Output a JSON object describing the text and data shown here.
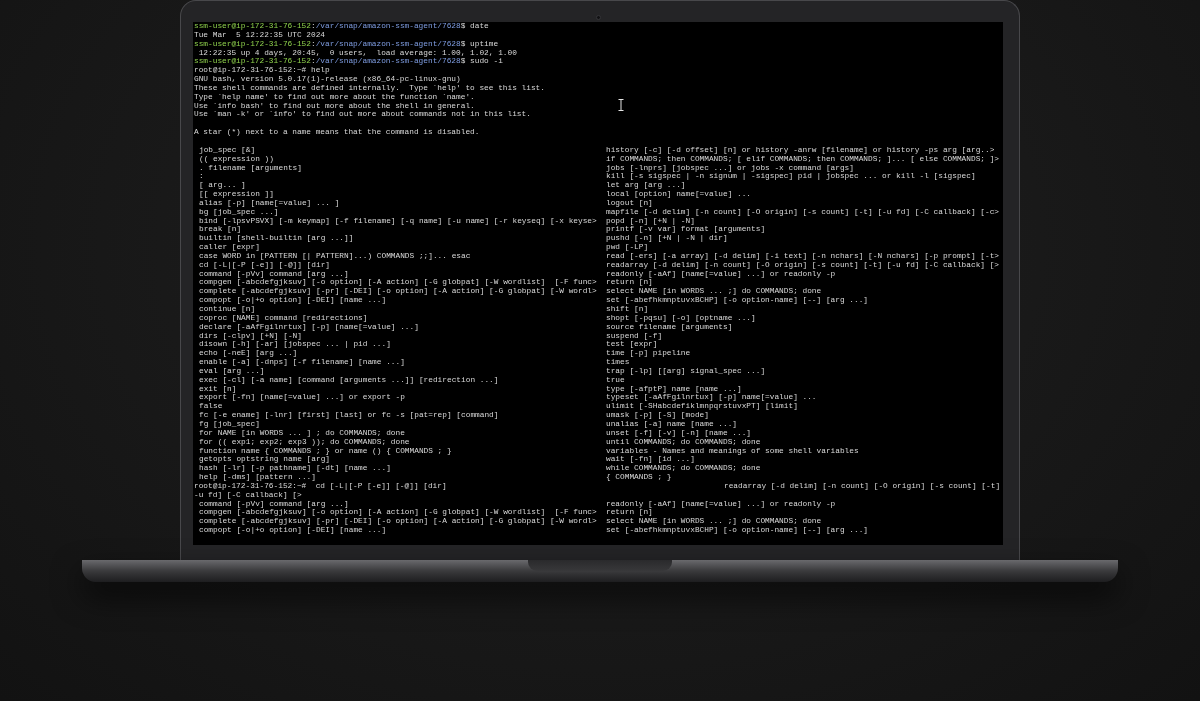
{
  "terminal": {
    "session": [
      {
        "kind": "prompt",
        "segments": [
          {
            "kind": "user",
            "text": "ssm-user@ip-172-31-76-152"
          },
          {
            "kind": "plain",
            "text": ":"
          },
          {
            "kind": "path",
            "text": "/var/snap/amazon-ssm-agent/7628"
          },
          {
            "kind": "plain",
            "text": "$ date"
          }
        ]
      },
      {
        "kind": "output",
        "text": "Tue Mar  5 12:22:35 UTC 2024"
      },
      {
        "kind": "prompt",
        "segments": [
          {
            "kind": "user",
            "text": "ssm-user@ip-172-31-76-152"
          },
          {
            "kind": "plain",
            "text": ":"
          },
          {
            "kind": "path",
            "text": "/var/snap/amazon-ssm-agent/7628"
          },
          {
            "kind": "plain",
            "text": "$ uptime"
          }
        ]
      },
      {
        "kind": "output",
        "text": " 12:22:35 up 4 days, 20:45,  0 users,  load average: 1.00, 1.02, 1.00"
      },
      {
        "kind": "prompt",
        "segments": [
          {
            "kind": "user",
            "text": "ssm-user@ip-172-31-76-152"
          },
          {
            "kind": "plain",
            "text": ":"
          },
          {
            "kind": "path",
            "text": "/var/snap/amazon-ssm-agent/7628"
          },
          {
            "kind": "plain",
            "text": "$ sudo -i"
          }
        ]
      },
      {
        "kind": "output",
        "text": "root@ip-172-31-76-152:~# help"
      },
      {
        "kind": "output",
        "text": "GNU bash, version 5.0.17(1)-release (x86_64-pc-linux-gnu)"
      },
      {
        "kind": "output",
        "text": "These shell commands are defined internally.  Type `help' to see this list."
      },
      {
        "kind": "output",
        "text": "Type `help name' to find out more about the function `name'."
      },
      {
        "kind": "output",
        "text": "Use `info bash' to find out more about the shell in general."
      },
      {
        "kind": "output",
        "text": "Use `man -k' or `info' to find out more about commands not in this list."
      },
      {
        "kind": "blank"
      },
      {
        "kind": "output",
        "text": "A star (*) next to a name means that the command is disabled."
      },
      {
        "kind": "blank"
      }
    ],
    "help_rows": [
      {
        "kind": "entry",
        "left": "job_spec [&]",
        "right": "history [-c] [-d offset] [n] or history -anrw [filename] or history -ps arg [arg..>"
      },
      {
        "kind": "entry",
        "left": "(( expression ))",
        "right": "if COMMANDS; then COMMANDS; [ elif COMMANDS; then COMMANDS; ]... [ else COMMANDS; ]>"
      },
      {
        "kind": "entry",
        "left": ". filename [arguments]",
        "right": "jobs [-lnprs] [jobspec ...] or jobs -x command [args]"
      },
      {
        "kind": "entry",
        "left": ":",
        "right": "kill [-s sigspec | -n signum | -sigspec] pid | jobspec ... or kill -l [sigspec]"
      },
      {
        "kind": "entry",
        "left": "[ arg... ]",
        "right": "let arg [arg ...]"
      },
      {
        "kind": "entry",
        "left": "[[ expression ]]",
        "right": "local [option] name[=value] ..."
      },
      {
        "kind": "entry",
        "left": "alias [-p] [name[=value] ... ]",
        "right": "logout [n]"
      },
      {
        "kind": "entry",
        "left": "bg [job_spec ...]",
        "right": "mapfile [-d delim] [-n count] [-O origin] [-s count] [-t] [-u fd] [-C callback] [-c>"
      },
      {
        "kind": "entry",
        "left": "bind [-lpsvPSVX] [-m keymap] [-f filename] [-q name] [-u name] [-r keyseq] [-x keyse>",
        "right": "popd [-n] [+N | -N]"
      },
      {
        "kind": "entry",
        "left": "break [n]",
        "right": "printf [-v var] format [arguments]"
      },
      {
        "kind": "entry",
        "left": "builtin [shell-builtin [arg ...]]",
        "right": "pushd [-n] [+N | -N | dir]"
      },
      {
        "kind": "entry",
        "left": "caller [expr]",
        "right": "pwd [-LP]"
      },
      {
        "kind": "entry",
        "left": "case WORD in [PATTERN [| PATTERN]...) COMMANDS ;;]... esac",
        "right": "read [-ers] [-a array] [-d delim] [-i text] [-n nchars] [-N nchars] [-p prompt] [-t>"
      },
      {
        "kind": "entry",
        "left": "cd [-L|[-P [-e]] [-@]] [dir]",
        "right": "readarray [-d delim] [-n count] [-O origin] [-s count] [-t] [-u fd] [-C callback] [>"
      },
      {
        "kind": "entry",
        "left": "command [-pVv] command [arg ...]",
        "right": "readonly [-aAf] [name[=value] ...] or readonly -p"
      },
      {
        "kind": "entry",
        "left": "compgen [-abcdefgjksuv] [-o option] [-A action] [-G globpat] [-W wordlist]  [-F func>",
        "right": "return [n]"
      },
      {
        "kind": "entry",
        "left": "complete [-abcdefgjksuv] [-pr] [-DEI] [-o option] [-A action] [-G globpat] [-W wordl>",
        "right": "select NAME [in WORDS ... ;] do COMMANDS; done"
      },
      {
        "kind": "entry",
        "left": "compopt [-o|+o option] [-DEI] [name ...]",
        "right": "set [-abefhkmnptuvxBCHP] [-o option-name] [--] [arg ...]"
      },
      {
        "kind": "entry",
        "left": "continue [n]",
        "right": "shift [n]"
      },
      {
        "kind": "entry",
        "left": "coproc [NAME] command [redirections]",
        "right": "shopt [-pqsu] [-o] [optname ...]"
      },
      {
        "kind": "entry",
        "left": "declare [-aAfFgilnrtux] [-p] [name[=value] ...]",
        "right": "source filename [arguments]"
      },
      {
        "kind": "entry",
        "left": "dirs [-clpv] [+N] [-N]",
        "right": "suspend [-f]"
      },
      {
        "kind": "entry",
        "left": "disown [-h] [-ar] [jobspec ... | pid ...]",
        "right": "test [expr]"
      },
      {
        "kind": "entry",
        "left": "echo [-neE] [arg ...]",
        "right": "time [-p] pipeline"
      },
      {
        "kind": "entry",
        "left": "enable [-a] [-dnps] [-f filename] [name ...]",
        "right": "times"
      },
      {
        "kind": "entry",
        "left": "eval [arg ...]",
        "right": "trap [-lp] [[arg] signal_spec ...]"
      },
      {
        "kind": "entry",
        "left": "exec [-cl] [-a name] [command [arguments ...]] [redirection ...]",
        "right": "true"
      },
      {
        "kind": "entry",
        "left": "exit [n]",
        "right": "type [-afptP] name [name ...]"
      },
      {
        "kind": "entry",
        "left": "export [-fn] [name[=value] ...] or export -p",
        "right": "typeset [-aAfFgilnrtux] [-p] name[=value] ..."
      },
      {
        "kind": "entry",
        "left": "false",
        "right": "ulimit [-SHabcdefiklmnpqrstuvxPT] [limit]"
      },
      {
        "kind": "entry",
        "left": "fc [-e ename] [-lnr] [first] [last] or fc -s [pat=rep] [command]",
        "right": "umask [-p] [-S] [mode]"
      },
      {
        "kind": "entry",
        "left": "fg [job_spec]",
        "right": "unalias [-a] name [name ...]"
      },
      {
        "kind": "entry",
        "left": "for NAME [in WORDS ... ] ; do COMMANDS; done",
        "right": "unset [-f] [-v] [-n] [name ...]"
      },
      {
        "kind": "entry",
        "left": "for (( exp1; exp2; exp3 )); do COMMANDS; done",
        "right": "until COMMANDS; do COMMANDS; done"
      },
      {
        "kind": "entry",
        "left": "function name { COMMANDS ; } or name () { COMMANDS ; }",
        "right": "variables - Names and meanings of some shell variables"
      },
      {
        "kind": "entry",
        "left": "getopts optstring name [arg]",
        "right": "wait [-fn] [id ...]"
      },
      {
        "kind": "entry",
        "left": "hash [-lr] [-p pathname] [-dt] [name ...]",
        "right": "while COMMANDS; do COMMANDS; done"
      },
      {
        "kind": "entry",
        "left": "help [-dms] [pattern ...]",
        "right": "{ COMMANDS ; }"
      },
      {
        "kind": "prompt",
        "left": "root@ip-172-31-76-152:~#  cd [-L|[-P [-e]] [-@]] [dir]",
        "right": "readarray [-d delim] [-n count] [-O origin] [-s count] [-t]"
      },
      {
        "kind": "wrap",
        "left": "-u fd] [-C callback] [>"
      },
      {
        "kind": "entry",
        "left": "command [-pVv] command [arg ...]",
        "right": "readonly [-aAf] [name[=value] ...] or readonly -p"
      },
      {
        "kind": "entry",
        "left": "compgen [-abcdefgjksuv] [-o option] [-A action] [-G globpat] [-W wordlist]  [-F func>",
        "right": "return [n]"
      },
      {
        "kind": "entry",
        "left": "complete [-abcdefgjksuv] [-pr] [-DEI] [-o option] [-A action] [-G globpat] [-W wordl>",
        "right": "select NAME [in WORDS ... ;] do COMMANDS; done"
      },
      {
        "kind": "entry",
        "left": "compopt [-o|+o option] [-DEI] [name ...]",
        "right": "set [-abefhkmnptuvxBCHP] [-o option-name] [--] [arg ...]"
      }
    ]
  }
}
